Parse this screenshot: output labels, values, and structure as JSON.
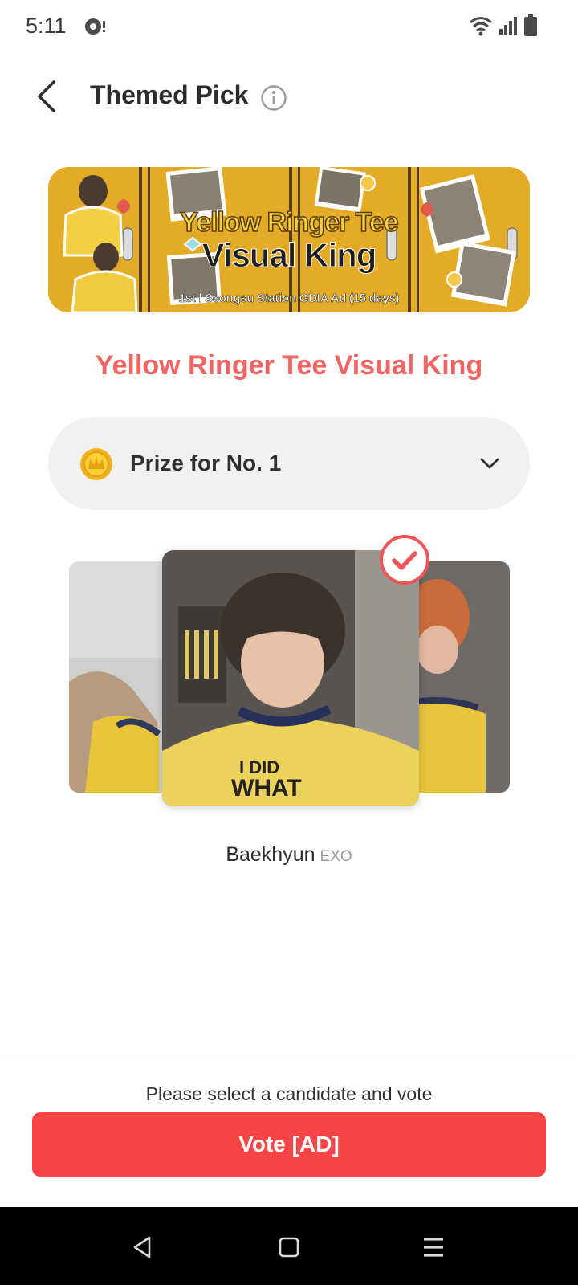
{
  "status_bar": {
    "time": "5:11"
  },
  "header": {
    "title": "Themed Pick",
    "back_icon": "chevron-left-icon",
    "info_icon": "info-icon"
  },
  "banner": {
    "title_line1": "Yellow Ringer Tee",
    "title_line2": "Visual King",
    "subtitle": "1st l Seongsu Station GDIA Ad (15 days)"
  },
  "pick": {
    "title": "Yellow Ringer Tee Visual King"
  },
  "prize": {
    "label": "Prize for No. 1",
    "coin_icon": "coin-icon",
    "expand_icon": "chevron-down-icon"
  },
  "candidate": {
    "name": "Baekhyun",
    "group": "EXO",
    "selected": true
  },
  "footer": {
    "hint": "Please select a candidate and vote",
    "vote_label": "Vote [AD]"
  },
  "colors": {
    "accent": "#f74446",
    "title_pink": "#f26464",
    "banner_yellow": "#e9b22e",
    "prize_bg": "#f1f1f1"
  }
}
